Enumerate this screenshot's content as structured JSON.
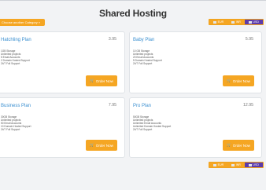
{
  "page": {
    "title": "Shared Hosting"
  },
  "category_button": {
    "label": "Choose another Category »"
  },
  "currencies": [
    {
      "code": "EUR",
      "active": false
    },
    {
      "code": "INR",
      "active": false
    },
    {
      "code": "USD",
      "active": true
    }
  ],
  "plans": [
    {
      "name": "Hatchling Plan",
      "price": "3.95",
      "features": [
        "1GB Storage",
        "Unlimited projects",
        "5 Email Accounts",
        "2 Domain Hosted Support",
        "24/7 Full Support"
      ]
    },
    {
      "name": "Baby Plan",
      "price": "5.95",
      "features": [
        "10 GB Storage",
        "Unlimited projects",
        "20 Email Accounts",
        "5 Domain Hosted Support",
        "24/7 Full Support"
      ]
    },
    {
      "name": "Business Plan",
      "price": "7.95",
      "features": [
        "30GB Storage",
        "Unlimited projects",
        "50 Email Accounts",
        "10 Domain Hosted Support",
        "24/7 Full Support"
      ]
    },
    {
      "name": "Pro Plan",
      "price": "12.95",
      "features": [
        "50GB Storage",
        "Unlimited projects",
        "Unlimited Email Accounts",
        "Unlimited Domain Hosted Support",
        "24/7 Full Support"
      ]
    }
  ],
  "order_button": {
    "label": "Order Now",
    "icon": "cart-icon"
  },
  "colors": {
    "accent": "#f5a623",
    "link": "#3a8fd0",
    "active_currency": "#5c3bab"
  }
}
